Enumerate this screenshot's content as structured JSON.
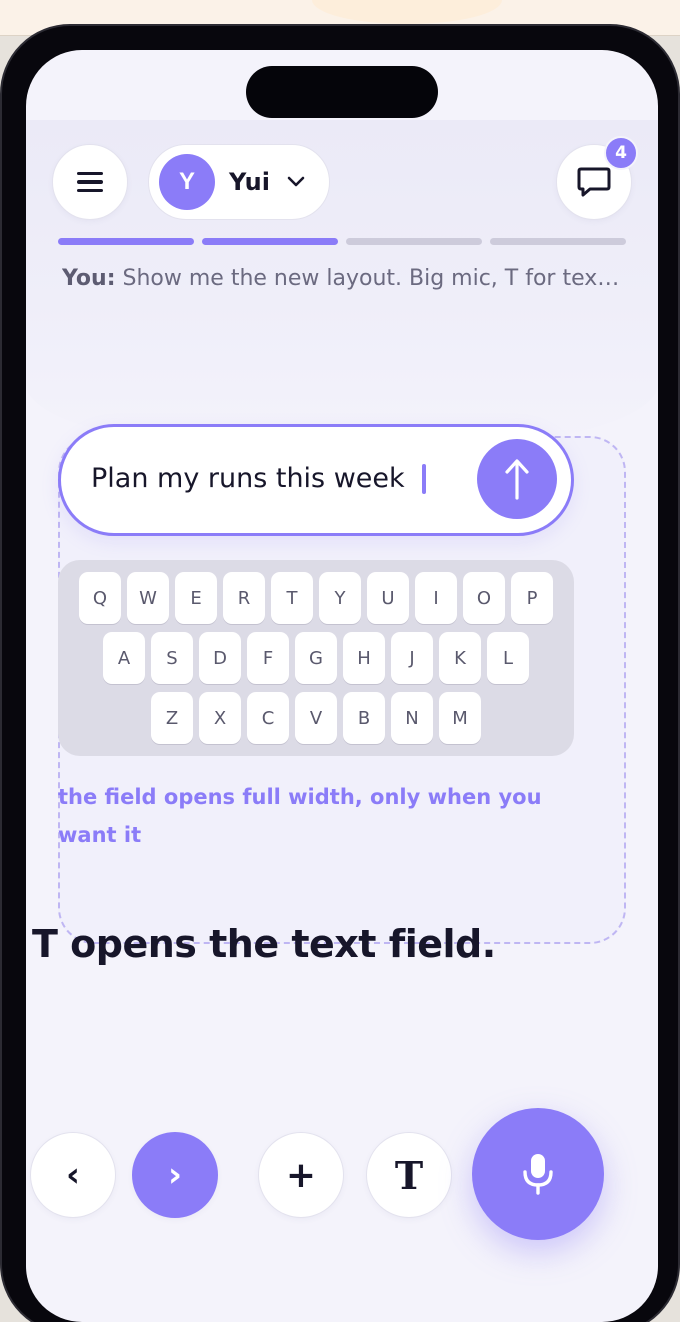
{
  "header": {
    "user": {
      "initial": "Y",
      "name": "Yui"
    },
    "chat_badge_count": "4",
    "progress_steps_total": 4,
    "progress_steps_done": 2
  },
  "transcript": {
    "speaker": "You:",
    "text": "Show me the new layout. Big mic, T for text..."
  },
  "demo": {
    "field_value": "Plan my runs this week",
    "keyboard": {
      "row1": [
        "Q",
        "W",
        "E",
        "R",
        "T",
        "Y",
        "U",
        "I",
        "O",
        "P"
      ],
      "row2": [
        "A",
        "S",
        "D",
        "F",
        "G",
        "H",
        "J",
        "K",
        "L"
      ],
      "row3": [
        "Z",
        "X",
        "C",
        "V",
        "B",
        "N",
        "M"
      ]
    },
    "hint": "the field opens full width, only when you want it"
  },
  "headline": "T opens the text field.",
  "controls": {
    "prev_label": "‹",
    "next_label": "›",
    "add_label": "+",
    "text_label": "T"
  },
  "icons": {
    "menu": "hamburger-icon",
    "chevron": "chevron-down-icon",
    "chat": "chat-bubble-icon",
    "send": "arrow-up-icon",
    "mic": "microphone-icon"
  },
  "colors": {
    "accent": "#8b7cf8",
    "ink": "#17162a",
    "screen": "#f4f3fb",
    "frame": "#08070d"
  }
}
